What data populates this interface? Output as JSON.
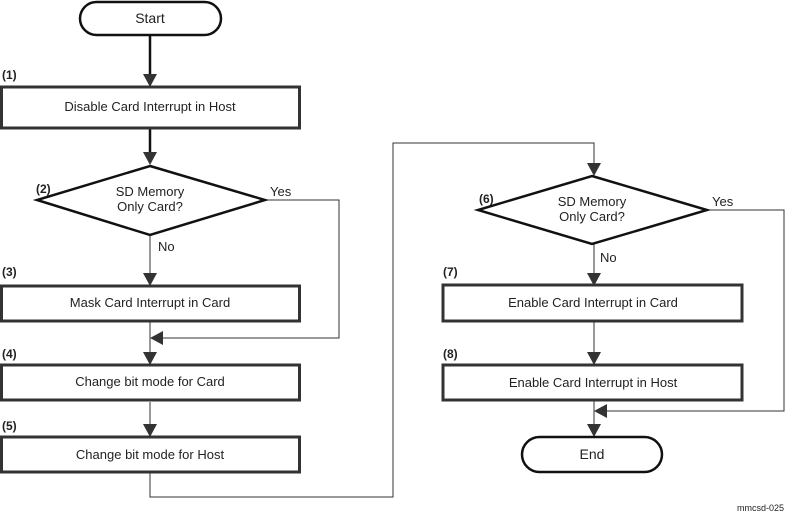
{
  "diagram": {
    "start": "Start",
    "end": "End",
    "steps": [
      {
        "num": "(1)",
        "label": "Disable Card Interrupt in Host"
      },
      {
        "num": "(2)",
        "line1": "SD Memory",
        "line2": "Only Card?"
      },
      {
        "num": "(3)",
        "label": "Mask Card Interrupt in Card"
      },
      {
        "num": "(4)",
        "label": "Change bit mode for Card"
      },
      {
        "num": "(5)",
        "label": "Change bit mode for Host"
      },
      {
        "num": "(6)",
        "line1": "SD Memory",
        "line2": "Only Card?"
      },
      {
        "num": "(7)",
        "label": "Enable Card Interrupt in Card"
      },
      {
        "num": "(8)",
        "label": "Enable Card Interrupt in Host"
      }
    ],
    "yes_label": "Yes",
    "no_label": "No",
    "figure_id": "mmcsd-025"
  }
}
